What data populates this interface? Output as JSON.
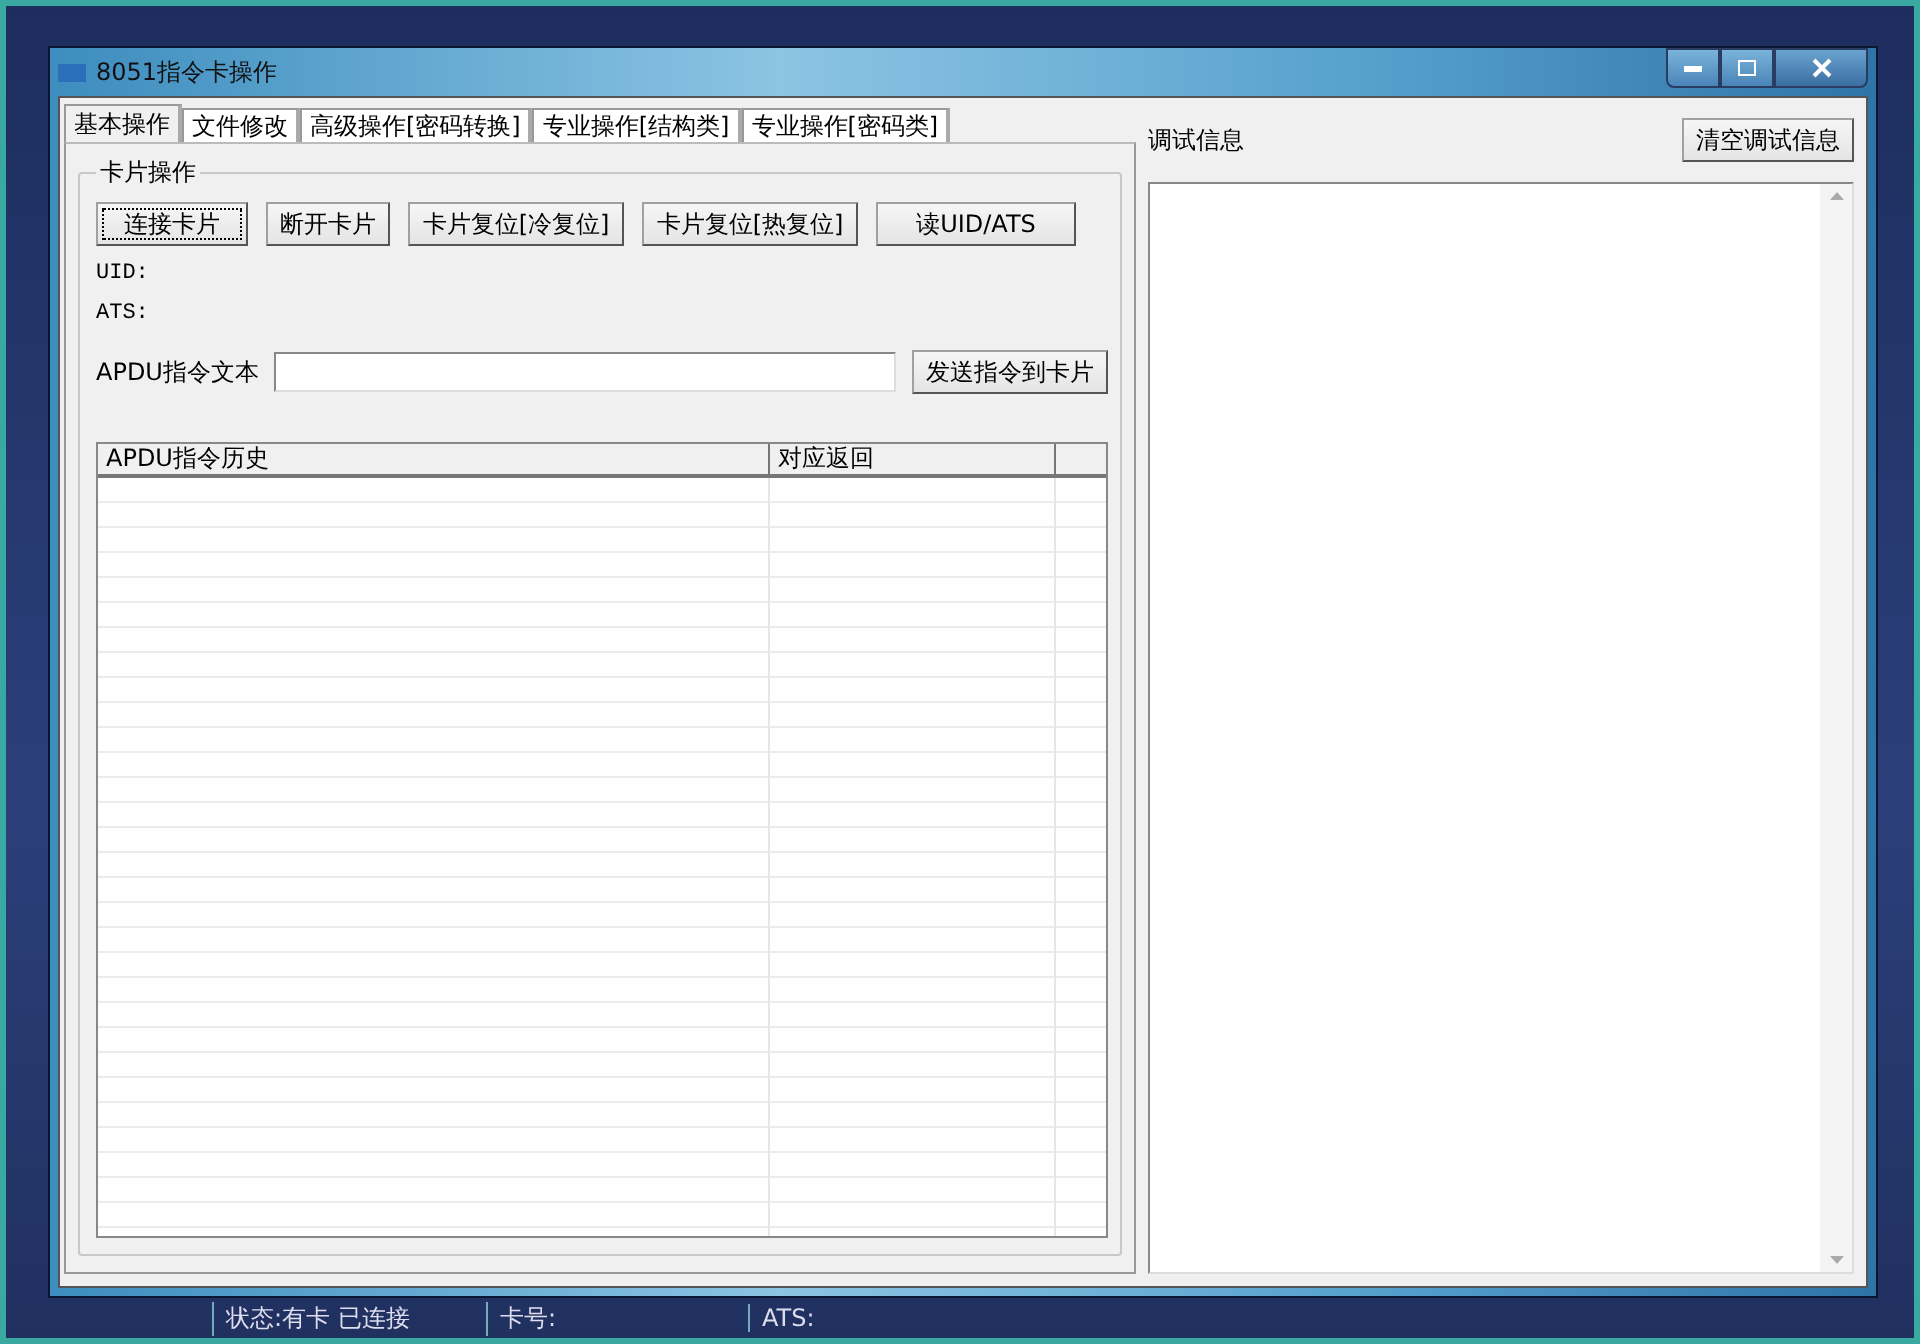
{
  "window": {
    "title": "8051指令卡操作"
  },
  "tabs": [
    {
      "label": "基本操作",
      "selected": true
    },
    {
      "label": "文件修改",
      "selected": false
    },
    {
      "label": "高级操作[密码转换]",
      "selected": false
    },
    {
      "label": "专业操作[结构类]",
      "selected": false
    },
    {
      "label": "专业操作[密码类]",
      "selected": false
    }
  ],
  "card_group": {
    "title": "卡片操作",
    "buttons": [
      {
        "label": "连接卡片",
        "focused": true
      },
      {
        "label": "断开卡片",
        "focused": false
      },
      {
        "label": "卡片复位[冷复位]",
        "focused": false
      },
      {
        "label": "卡片复位[热复位]",
        "focused": false
      },
      {
        "label": "读UID/ATS",
        "focused": false
      }
    ],
    "uid_label": "UID:",
    "ats_label": "ATS:",
    "apdu_label": "APDU指令文本",
    "send_button": "发送指令到卡片"
  },
  "history_table": {
    "columns": [
      "APDU指令历史",
      "对应返回"
    ]
  },
  "debug": {
    "label": "调试信息",
    "clear_button": "清空调试信息"
  },
  "status_bar": [
    "状态:有卡 已连接",
    "卡号:",
    "ATS:"
  ]
}
